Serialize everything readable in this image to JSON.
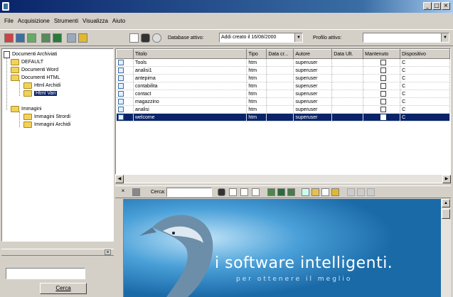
{
  "window": {
    "title": "",
    "buttons": [
      "_",
      "□",
      "×"
    ]
  },
  "menu": [
    "File",
    "Acquisizione",
    "Strumenti",
    "Visualizza",
    "Aiuto"
  ],
  "toolbar": {
    "db_label": "Database attivo:",
    "db_value": "Addi creato il 16/08/2000",
    "profile_label": "Profilo attivo:",
    "profile_value": ""
  },
  "tree": {
    "root": "Documenti Archiviati",
    "items": [
      {
        "label": "DEFAULT",
        "level": 1
      },
      {
        "label": "Documenti Word",
        "level": 1
      },
      {
        "label": "Documenti HTML",
        "level": 1
      },
      {
        "label": "Html Archidi",
        "level": 2
      },
      {
        "label": "Html Vari",
        "level": 2,
        "selected": true
      },
      {
        "label": "Immagini",
        "level": 1
      },
      {
        "label": "Immagini Strordi",
        "level": 2
      },
      {
        "label": "Immagini Archidi",
        "level": 2
      }
    ]
  },
  "search": {
    "value": "",
    "button_label": "Cerca"
  },
  "list": {
    "columns": [
      "Titolo",
      "Tipo",
      "Data cr...",
      "Autore",
      "Data Ult.",
      "Mantenuto",
      "Dispositivo"
    ],
    "rows": [
      {
        "title": "Tools",
        "type": "htm",
        "created": "",
        "author": "superuser",
        "updated": "",
        "kept": false,
        "device": "C"
      },
      {
        "title": "analisi1",
        "type": "htm",
        "created": "",
        "author": "superuser",
        "updated": "",
        "kept": false,
        "device": "C"
      },
      {
        "title": "antepima",
        "type": "htm",
        "created": "",
        "author": "superuser",
        "updated": "",
        "kept": false,
        "device": "C"
      },
      {
        "title": "contabilita",
        "type": "htm",
        "created": "",
        "author": "superuser",
        "updated": "",
        "kept": false,
        "device": "C"
      },
      {
        "title": "contact",
        "type": "htm",
        "created": "",
        "author": "superuser",
        "updated": "",
        "kept": false,
        "device": "C"
      },
      {
        "title": "magazzino",
        "type": "htm",
        "created": "",
        "author": "superuser",
        "updated": "",
        "kept": false,
        "device": "C"
      },
      {
        "title": "analisi",
        "type": "htm",
        "created": "",
        "author": "superuser",
        "updated": "",
        "kept": false,
        "device": "C"
      },
      {
        "title": "welcome",
        "type": "htm",
        "created": "",
        "author": "superuser",
        "updated": "",
        "kept": false,
        "device": "C",
        "selected": true
      }
    ]
  },
  "preview_toolbar": {
    "search_label": "Cerca:",
    "search_value": ""
  },
  "preview": {
    "slogan": "i software intelligenti.",
    "tagline": "per ottenere il meglio"
  },
  "colors": {
    "title_bar": "#0a246a",
    "selection": "#0a246a",
    "folder": "#f3d25a",
    "preview_bg": "#2a8ac8"
  }
}
